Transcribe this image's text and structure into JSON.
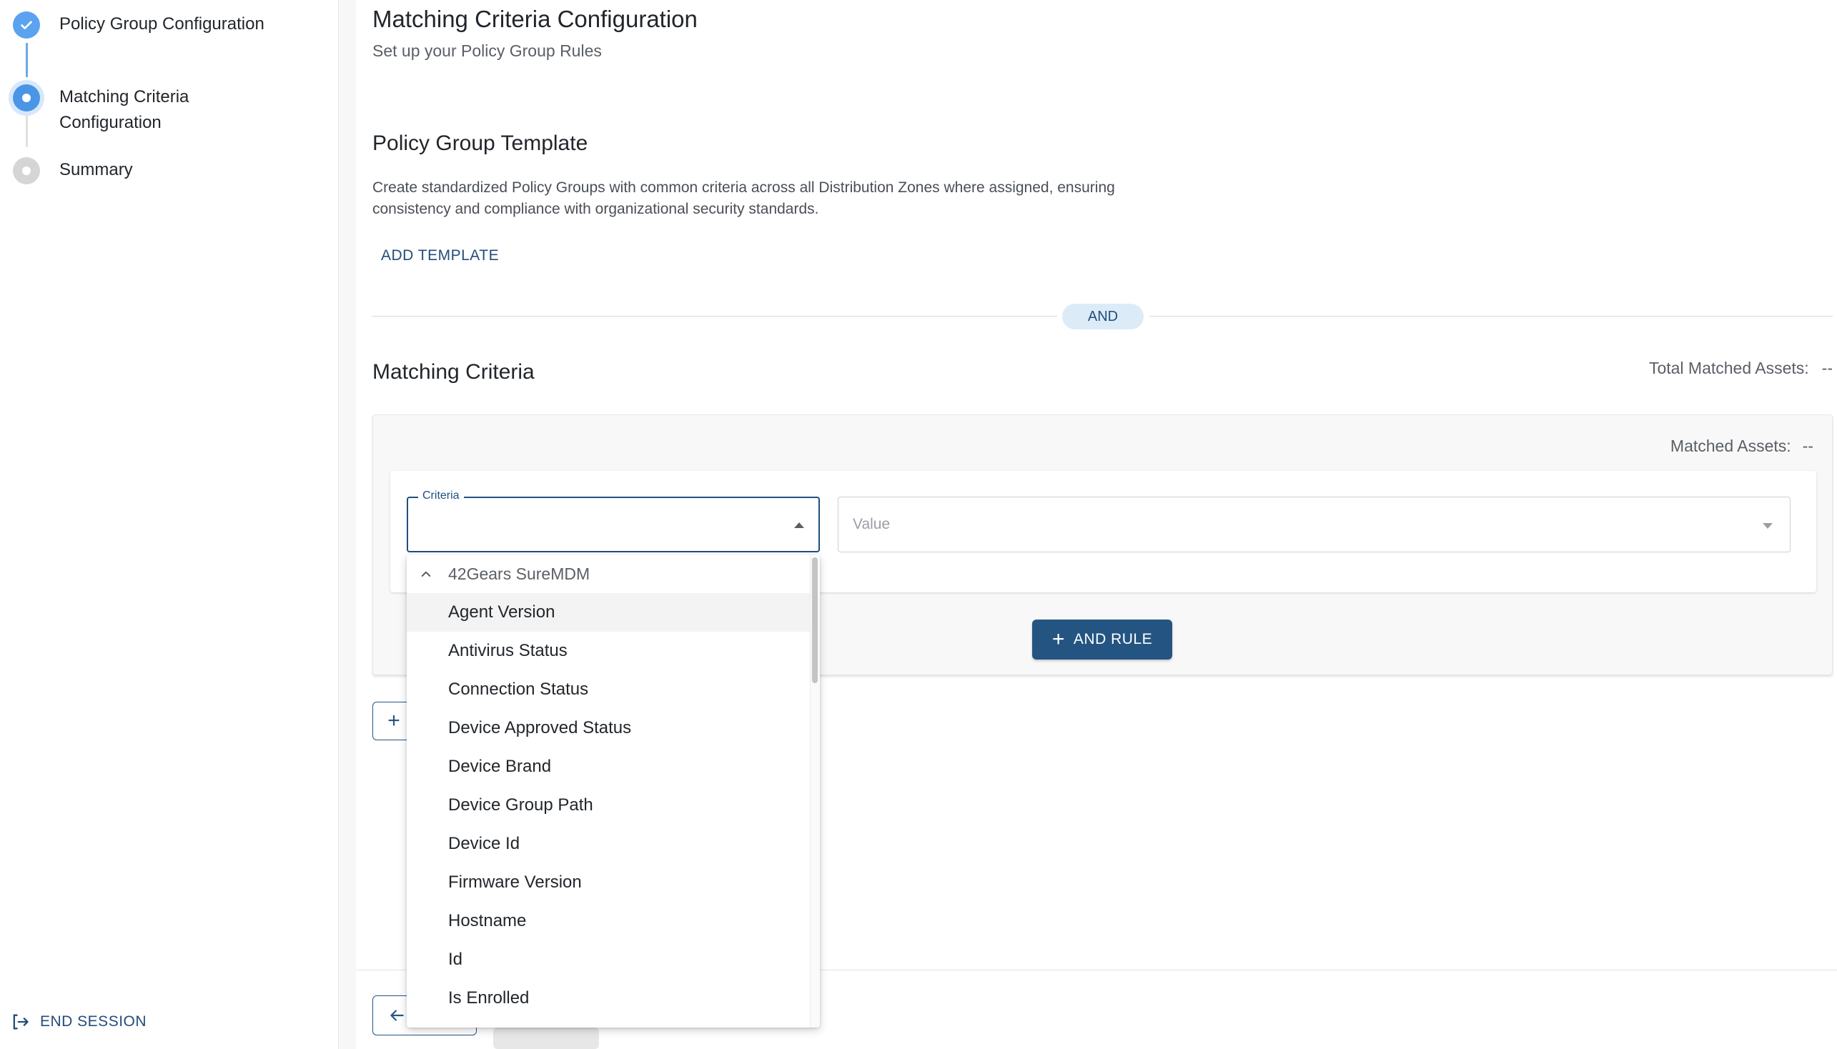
{
  "stepper": {
    "steps": [
      {
        "label": "Policy Group Configuration",
        "state": "done"
      },
      {
        "label": "Matching Criteria Configuration",
        "state": "active"
      },
      {
        "label": "Summary",
        "state": "pending"
      }
    ]
  },
  "sidebar": {
    "end_session_label": "END SESSION"
  },
  "header": {
    "title": "Matching Criteria Configuration",
    "subtitle": "Set up your Policy Group Rules"
  },
  "template_section": {
    "title": "Policy Group Template",
    "description": "Create standardized Policy Groups with common criteria across all Distribution Zones where assigned, ensuring consistency and compliance with organizational security standards.",
    "add_label": "ADD TEMPLATE"
  },
  "operator_chip": "AND",
  "criteria_section": {
    "title": "Matching Criteria",
    "total_matched_label": "Total Matched Assets:",
    "total_matched_value": "--",
    "matched_label": "Matched Assets:",
    "matched_value": "--",
    "criteria_field_label": "Criteria",
    "value_placeholder": "Value",
    "and_rule_label": "AND RULE"
  },
  "dropdown": {
    "group_label": "42Gears SureMDM",
    "items": [
      "Agent Version",
      "Antivirus Status",
      "Connection Status",
      "Device Approved Status",
      "Device Brand",
      "Device Group Path",
      "Device Id",
      "Firmware Version",
      "Hostname",
      "Id",
      "Is Enrolled"
    ],
    "hovered_index": 0
  },
  "colors": {
    "primary": "#245582",
    "step_done": "#5ba3f0",
    "step_active": "#4a95e6",
    "chip_bg": "#dcebf8"
  }
}
